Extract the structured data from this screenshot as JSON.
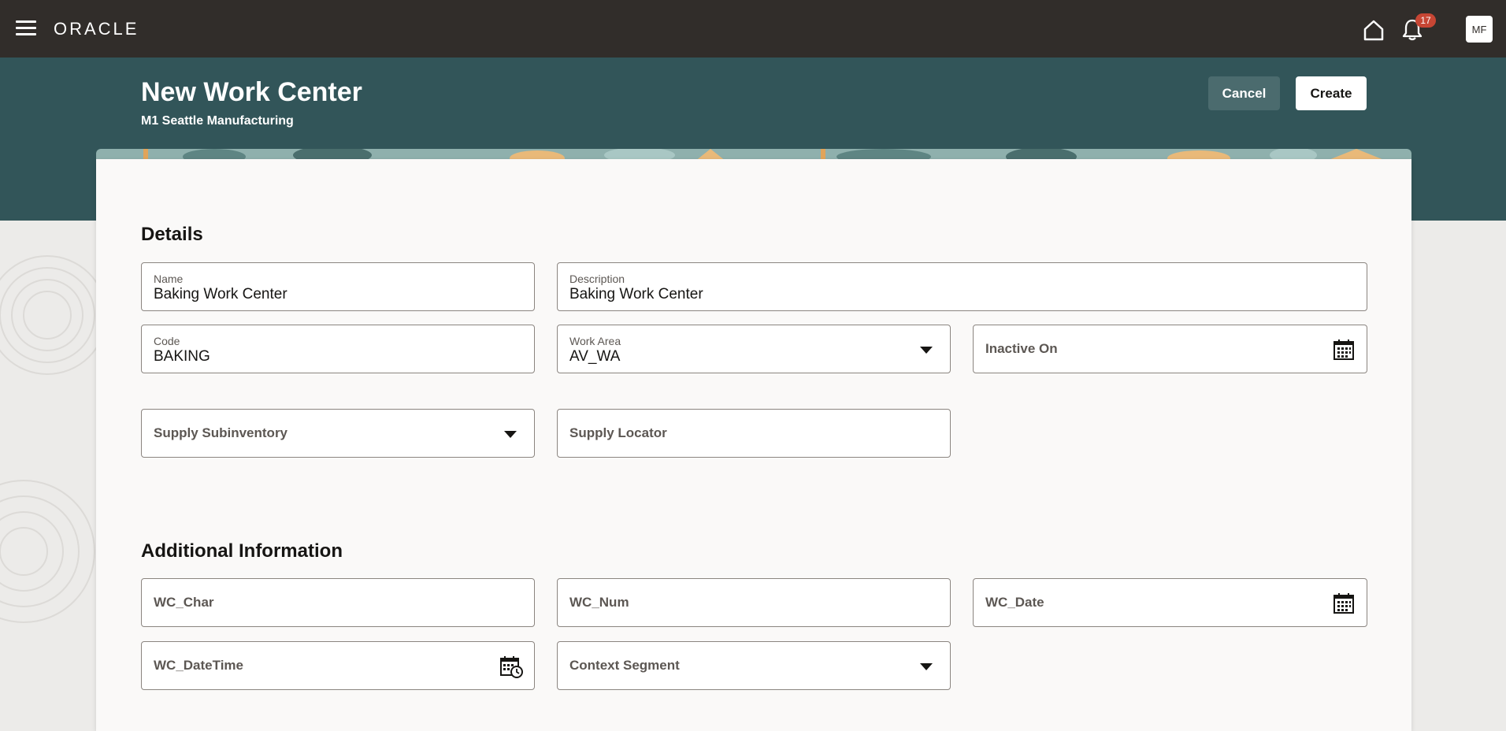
{
  "topbar": {
    "logo": "ORACLE",
    "notification_count": "17",
    "avatar_initials": "MF"
  },
  "header": {
    "title": "New Work Center",
    "subtitle": "M1 Seattle Manufacturing",
    "cancel_label": "Cancel",
    "create_label": "Create"
  },
  "details": {
    "section_title": "Details",
    "name": {
      "label": "Name",
      "value": "Baking Work Center"
    },
    "description": {
      "label": "Description",
      "value": "Baking Work Center"
    },
    "code": {
      "label": "Code",
      "value": "BAKING"
    },
    "work_area": {
      "label": "Work Area",
      "value": "AV_WA"
    },
    "inactive_on": {
      "label": "Inactive On"
    },
    "supply_subinventory": {
      "label": "Supply Subinventory"
    },
    "supply_locator": {
      "label": "Supply Locator"
    }
  },
  "additional": {
    "section_title": "Additional Information",
    "wc_char": {
      "label": "WC_Char"
    },
    "wc_num": {
      "label": "WC_Num"
    },
    "wc_date": {
      "label": "WC_Date"
    },
    "wc_datetime": {
      "label": "WC_DateTime"
    },
    "context_segment": {
      "label": "Context Segment"
    }
  },
  "colors": {
    "topbar": "#312d2a",
    "header_band": "#325559",
    "cancel_button": "#4b6b6e",
    "badge": "#c74634"
  }
}
